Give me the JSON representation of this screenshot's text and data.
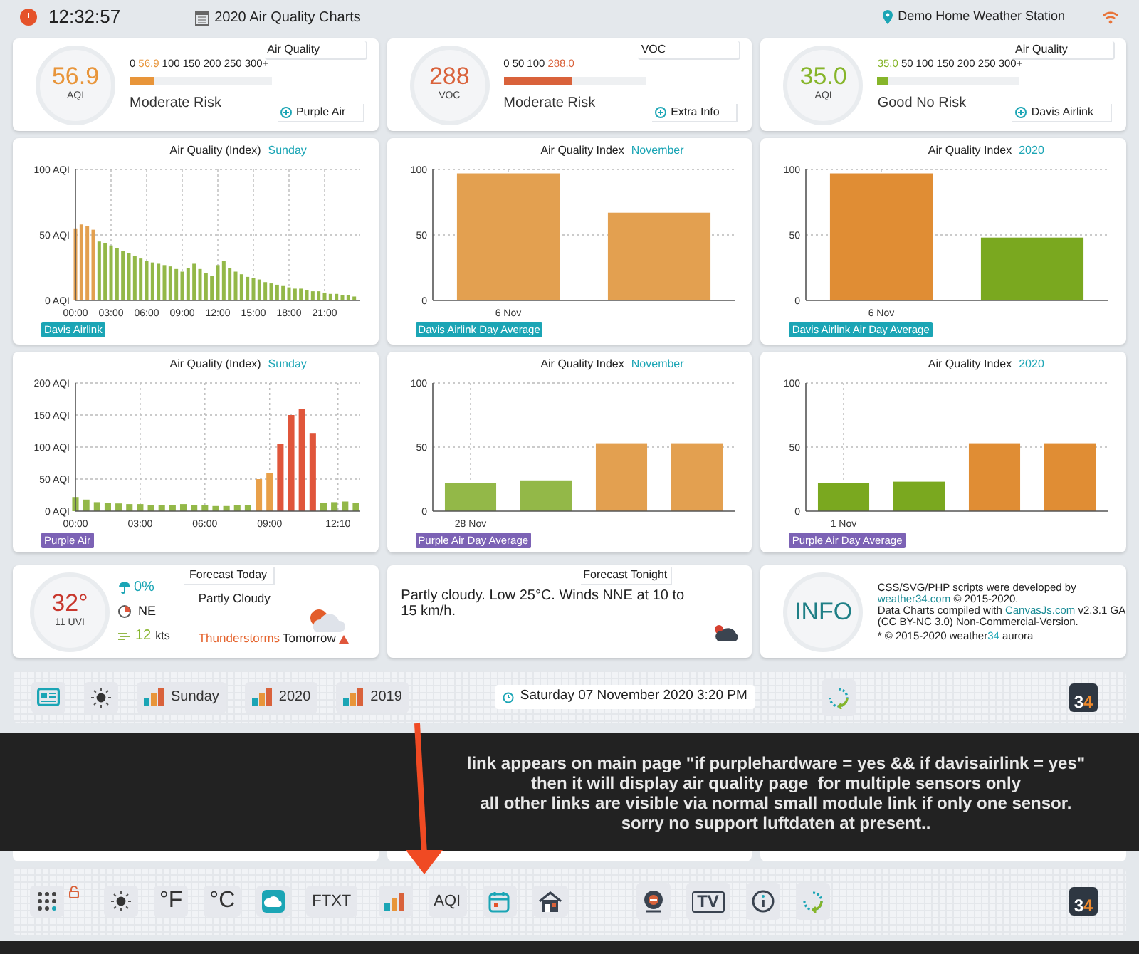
{
  "top_bar": {
    "time": "12:32:57",
    "title": "2020 Air Quality Charts",
    "station": "Demo Home Weather Station"
  },
  "sensor_cards": [
    {
      "value": "56.9",
      "unit": "AQI",
      "color": "#e8953a",
      "scale": [
        {
          "text": "0",
          "selected": false
        },
        {
          "text": "56.9",
          "selected": true
        },
        {
          "text": "100",
          "selected": false
        },
        {
          "text": "150",
          "selected": false
        },
        {
          "text": "200",
          "selected": false
        },
        {
          "text": "250",
          "selected": false
        },
        {
          "text": "300+",
          "selected": false
        }
      ],
      "level": 0.17,
      "risk": "Moderate Risk",
      "label": "Air Quality",
      "link": "Purple Air"
    },
    {
      "value": "288",
      "unit": "VOC",
      "color": "#d9623b",
      "scale": [
        {
          "text": "0",
          "selected": false
        },
        {
          "text": "50",
          "selected": false
        },
        {
          "text": "100",
          "selected": false
        },
        {
          "text": "288.0",
          "selected": true
        }
      ],
      "level": 0.48,
      "risk": "Moderate Risk",
      "label": "VOC",
      "link": "Extra Info"
    },
    {
      "value": "35.0",
      "unit": "AQI",
      "color": "#86b52a",
      "scale": [
        {
          "text": "35.0",
          "selected": true
        },
        {
          "text": "50",
          "selected": false
        },
        {
          "text": "100",
          "selected": false
        },
        {
          "text": "150",
          "selected": false
        },
        {
          "text": "200",
          "selected": false
        },
        {
          "text": "250",
          "selected": false
        },
        {
          "text": "300+",
          "selected": false
        }
      ],
      "level": 0.08,
      "risk": "Good No Risk",
      "label": "Air Quality",
      "link": "Davis Airlink"
    }
  ],
  "chart_cards": [
    {
      "period": "Sunday",
      "tag": "Davis Airlink",
      "color": "#1ba5b5",
      "chart_data": {
        "type": "bar",
        "title": "Air Quality (Index)",
        "grid": true,
        "xlim": [
          0,
          24
        ],
        "ylim": [
          0,
          100
        ],
        "yticks": [
          {
            "value": 0,
            "label": "0 AQI"
          },
          {
            "value": 50,
            "label": "50 AQI"
          },
          {
            "value": 100,
            "label": "100 AQI"
          }
        ],
        "xticks": [
          {
            "value": 0,
            "label": "00:00"
          },
          {
            "value": 3,
            "label": "03:00"
          },
          {
            "value": 6,
            "label": "06:00"
          },
          {
            "value": 9,
            "label": "09:00"
          },
          {
            "value": 12,
            "label": "12:00"
          },
          {
            "value": 15,
            "label": "15:00"
          },
          {
            "value": 18,
            "label": "18:00"
          },
          {
            "value": 21,
            "label": "21:00"
          }
        ],
        "x": [
          0,
          0.5,
          1,
          1.5,
          2,
          2.5,
          3,
          3.5,
          4,
          4.5,
          5,
          5.5,
          6,
          6.5,
          7,
          7.5,
          8,
          8.5,
          9,
          9.5,
          10,
          10.5,
          11,
          11.5,
          12,
          12.5,
          13,
          13.5,
          14,
          14.5,
          15,
          15.5,
          16,
          16.5,
          17,
          17.5,
          18,
          18.5,
          19,
          19.5,
          20,
          20.5,
          21,
          21.5,
          22,
          22.5,
          23,
          23.5
        ],
        "series": [
          {
            "color": "#93b848",
            "values": [
              null,
              null,
              null,
              null,
              45,
              44,
              42,
              40,
              38,
              36,
              34,
              32,
              30,
              29,
              28,
              27,
              26,
              24,
              22,
              25,
              28,
              24,
              21,
              19,
              27,
              30,
              25,
              22,
              20,
              18,
              17,
              16,
              14,
              13,
              12,
              11,
              10,
              9,
              9,
              8,
              7,
              7,
              6,
              5,
              5,
              4,
              4,
              3
            ]
          },
          {
            "color": "#e3a050",
            "values": [
              55,
              58,
              57,
              54,
              null,
              null,
              null,
              null,
              null,
              null,
              null,
              null,
              null,
              null,
              null,
              null,
              null,
              null,
              null,
              null,
              null,
              null,
              null,
              null,
              null,
              null,
              null,
              null,
              null,
              null,
              null,
              null,
              null,
              null,
              null,
              null,
              null,
              null,
              null,
              null,
              null,
              null,
              null,
              null,
              null,
              null,
              null,
              null
            ]
          }
        ]
      }
    },
    {
      "period": "November",
      "tag": "Davis Airlink Day Average",
      "color": "#1ba5b5",
      "chart_data": {
        "type": "bar",
        "title": "Air Quality  Index",
        "grid": true,
        "ylim": [
          0,
          100
        ],
        "yticks": [
          0,
          50,
          100
        ],
        "categories": [
          "6 Nov",
          null
        ],
        "series": [
          {
            "color": "#e3a050",
            "values": [
              97,
              67
            ]
          }
        ]
      }
    },
    {
      "period": "2020",
      "tag": "Davis Airlink Air Day Average",
      "color": "#1ba5b5",
      "chart_data": {
        "type": "bar",
        "title": "Air Quality  Index",
        "grid": true,
        "ylim": [
          0,
          100
        ],
        "yticks": [
          0,
          50,
          100
        ],
        "categories": [
          "6 Nov",
          null
        ],
        "series": [
          {
            "color": "#e08d34",
            "values": [
              97,
              null
            ]
          },
          {
            "color": "#7aa81f",
            "values": [
              null,
              48
            ]
          }
        ]
      }
    },
    {
      "period": "Sunday",
      "tag": "Purple Air",
      "color": "#7c62b5",
      "chart_data": {
        "type": "bar",
        "title": "Air Quality  (Index)",
        "grid": true,
        "xlim": [
          0,
          13.2
        ],
        "ylim": [
          0,
          200
        ],
        "yticks": [
          {
            "value": 0,
            "label": "0 AQI"
          },
          {
            "value": 50,
            "label": "50 AQI"
          },
          {
            "value": 100,
            "label": "100 AQI"
          },
          {
            "value": 150,
            "label": "150 AQI"
          },
          {
            "value": 200,
            "label": "200 AQI"
          }
        ],
        "xticks": [
          {
            "value": 0,
            "label": "00:00"
          },
          {
            "value": 3,
            "label": "03:00"
          },
          {
            "value": 6,
            "label": "06:00"
          },
          {
            "value": 9,
            "label": "09:00"
          },
          {
            "value": 12.17,
            "label": "12:10"
          }
        ],
        "x": [
          0,
          0.5,
          1,
          1.5,
          2,
          2.5,
          3,
          3.5,
          4,
          4.5,
          5,
          5.5,
          6,
          6.5,
          7,
          7.5,
          8,
          8.5,
          9,
          9.5,
          10,
          10.5,
          11,
          11.5,
          12,
          12.5,
          13
        ],
        "series": [
          {
            "color": "#93b848",
            "values": [
              22,
              18,
              14,
              13,
              12,
              11,
              11,
              10,
              10,
              10,
              11,
              10,
              9,
              8,
              8,
              9,
              9,
              null,
              null,
              null,
              null,
              null,
              null,
              13,
              14,
              15,
              13
            ]
          },
          {
            "color": "#e8a04a",
            "values": [
              null,
              null,
              null,
              null,
              null,
              null,
              null,
              null,
              null,
              null,
              null,
              null,
              null,
              null,
              null,
              null,
              null,
              50,
              60,
              null,
              null,
              null,
              null,
              null,
              null,
              null,
              null
            ]
          },
          {
            "color": "#e0563b",
            "values": [
              null,
              null,
              null,
              null,
              null,
              null,
              null,
              null,
              null,
              null,
              null,
              null,
              null,
              null,
              null,
              null,
              null,
              null,
              null,
              105,
              150,
              160,
              122,
              null,
              null,
              null,
              null
            ]
          }
        ]
      }
    },
    {
      "period": "November",
      "tag": "Purple Air Day Average",
      "color": "#7c62b5",
      "chart_data": {
        "type": "bar",
        "title": "Air Quality  Index",
        "grid": true,
        "ylim": [
          0,
          100
        ],
        "yticks": [
          0,
          50,
          100
        ],
        "categories": [
          "28 Nov",
          null,
          null,
          null
        ],
        "series": [
          {
            "color": "#93b848",
            "values": [
              22,
              24,
              null,
              null
            ]
          },
          {
            "color": "#e3a050",
            "values": [
              null,
              null,
              53,
              53
            ]
          }
        ]
      }
    },
    {
      "period": "2020",
      "tag": "Purple Air Day Average",
      "color": "#7c62b5",
      "chart_data": {
        "type": "bar",
        "title": "Air Quality  Index",
        "grid": true,
        "ylim": [
          0,
          100
        ],
        "yticks": [
          0,
          50,
          100
        ],
        "categories": [
          "1 Nov",
          null,
          null,
          null
        ],
        "series": [
          {
            "color": "#7aa81f",
            "values": [
              22,
              23,
              null,
              null
            ]
          },
          {
            "color": "#e08d34",
            "values": [
              null,
              null,
              53,
              53
            ]
          }
        ]
      }
    }
  ],
  "forecast_today": {
    "label": "Forecast Today",
    "temp": "32°",
    "uvi": "11 UVI",
    "rain": "0%",
    "wind_dir": "NE",
    "wind_speed": "12",
    "wind_unit": "kts",
    "summary": "Partly Cloudy",
    "alert": "Thunderstorms",
    "alert_when": "Tomorrow"
  },
  "forecast_tonight": {
    "label": "Forecast Tonight",
    "text": "Partly cloudy. Low 25°C. Winds NNE at 10 to 15 km/h."
  },
  "info": {
    "badge": "INFO",
    "paragraphs": [
      [
        {
          "kind": "text",
          "text": "CSS/SVG/PHP scripts were developed by"
        },
        {
          "kind": "link",
          "text": "weather34.com"
        },
        {
          "kind": "text",
          "text": "© 2015-2020."
        }
      ],
      [
        {
          "kind": "text",
          "text": "Data Charts compiled with"
        },
        {
          "kind": "link",
          "text": "CanvasJs.com"
        },
        {
          "kind": "text",
          "text": "v2.3.1 GA (CC BY-NC 3.0) Non-Commercial-Version."
        }
      ],
      [
        {
          "kind": "text",
          "text": "* © 2015-2020 weather"
        },
        {
          "kind": "accent",
          "text": "34"
        },
        {
          "kind": "text",
          "text": "aurora"
        }
      ]
    ]
  },
  "nav_bar": [
    {
      "kind": "card"
    },
    {
      "kind": "sun"
    },
    {
      "kind": "chart",
      "label": "Sunday"
    },
    {
      "kind": "chart",
      "label": "2020"
    },
    {
      "kind": "chart",
      "label": "2019"
    },
    {
      "kind": "date",
      "label": "Saturday 07 November 2020 3:20 PM"
    },
    {
      "kind": "refresh"
    },
    {
      "kind": "logo",
      "label": "3",
      "accent": "4"
    }
  ],
  "annotation": {
    "lines": [
      "link appears on main page \"if purplehardware = yes && if davisairlink = yes\"",
      "then it will display air quality page  for multiple sensors only",
      "all other links are visible via normal small module link if only one sensor.",
      "sorry no support luftdaten at present.."
    ]
  },
  "bottom_nav": [
    {
      "kind": "dots"
    },
    {
      "kind": "sun"
    },
    {
      "kind": "text",
      "label": "°F"
    },
    {
      "kind": "text",
      "label": "°C"
    },
    {
      "kind": "cloud"
    },
    {
      "kind": "text",
      "label": "FTXT"
    },
    {
      "kind": "chart"
    },
    {
      "kind": "text",
      "label": "AQI"
    },
    {
      "kind": "calendar"
    },
    {
      "kind": "house"
    },
    {
      "kind": "webcam"
    },
    {
      "kind": "tv",
      "label": "TV"
    },
    {
      "kind": "info"
    },
    {
      "kind": "refresh"
    },
    {
      "kind": "logo",
      "label": "3",
      "accent": "4"
    }
  ]
}
